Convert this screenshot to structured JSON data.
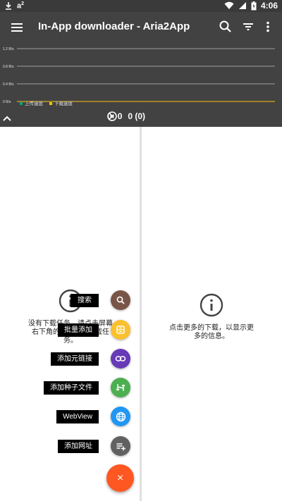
{
  "status_bar": {
    "time": "4:06",
    "left_icons": [
      "download-arrow-icon",
      "a-squared-icon"
    ],
    "right_icons": [
      "wifi-icon",
      "signal-icon",
      "battery-icon"
    ]
  },
  "app_bar": {
    "title": "In-App downloader - Aria2App",
    "icons": [
      "menu-icon",
      "search-icon",
      "filter-icon",
      "more-vert-icon"
    ],
    "background": "#424242"
  },
  "chart_data": {
    "type": "line",
    "y_tick_labels": [
      "1.2 B/s",
      "0.8 B/s",
      "0.4 B/s",
      "0 B/s"
    ],
    "ylim": [
      0,
      1.2
    ],
    "series": [
      {
        "name": "上传速度",
        "color": "#00a67e",
        "values": [
          0
        ]
      },
      {
        "name": "下载速度",
        "color": "#ffc107",
        "values": [
          0
        ]
      }
    ],
    "grid": true,
    "legend_placement": "bottom-left"
  },
  "summary": {
    "active_count": "0",
    "paused_count": "0",
    "stopped_count": "0 (0)"
  },
  "left_empty_text": "没有下载任务。请点击屏幕右下角的按钮添加下载任务。",
  "right_empty_text": "点击更多的下载，以显示更多的信息。",
  "fab_menu": {
    "items": [
      {
        "label": "搜索",
        "icon": "search-icon",
        "color": "#795548"
      },
      {
        "label": "批量添加",
        "icon": "batch-add-icon",
        "color": "#fbc02d"
      },
      {
        "label": "添加元链接",
        "icon": "link-icon",
        "color": "#673ab7"
      },
      {
        "label": "添加种子文件",
        "icon": "torrent-icon",
        "color": "#4caf50"
      },
      {
        "label": "WebView",
        "icon": "globe-icon",
        "color": "#2196f3"
      },
      {
        "label": "添加网址",
        "icon": "add-url-icon",
        "color": "#616161"
      }
    ],
    "main_icon": "close-icon",
    "main_color": "#ff5722",
    "main_glyph": "×"
  }
}
